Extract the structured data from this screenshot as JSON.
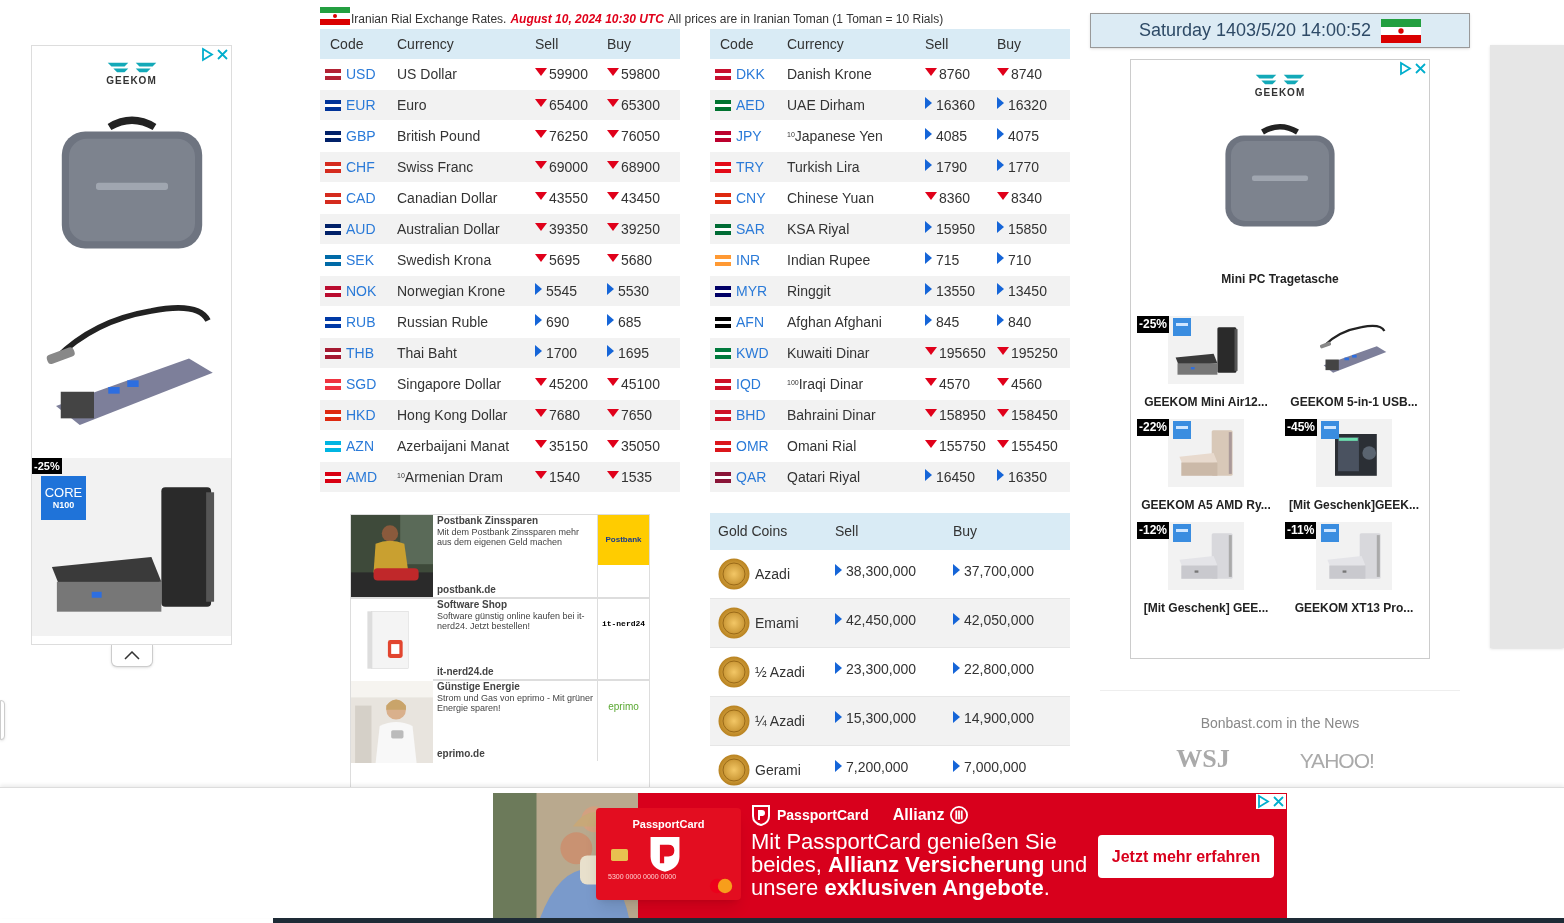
{
  "header": {
    "title": "Iranian Rial Exchange Rates.",
    "date": "August 10, 2024 10:30 UTC",
    "note": "All prices are in Iranian Toman (1 Toman = 10 Rials)"
  },
  "clock": {
    "text": "Saturday 1403/5/20 14:00:52"
  },
  "currency_tables": [
    {
      "columns": [
        "Code",
        "Currency",
        "Sell",
        "Buy"
      ],
      "rows": [
        {
          "code": "USD",
          "currency": "US Dollar",
          "color": "#b22234",
          "sell": "59900",
          "sell_up": false,
          "buy": "59800",
          "buy_up": false
        },
        {
          "code": "EUR",
          "currency": "Euro",
          "color": "#003399",
          "sell": "65400",
          "sell_up": false,
          "buy": "65300",
          "buy_up": false
        },
        {
          "code": "GBP",
          "currency": "British Pound",
          "color": "#012169",
          "sell": "76250",
          "sell_up": false,
          "buy": "76050",
          "buy_up": false
        },
        {
          "code": "CHF",
          "currency": "Swiss Franc",
          "color": "#d52b1e",
          "sell": "69000",
          "sell_up": false,
          "buy": "68900",
          "buy_up": false
        },
        {
          "code": "CAD",
          "currency": "Canadian Dollar",
          "color": "#d52b1e",
          "sell": "43550",
          "sell_up": false,
          "buy": "43450",
          "buy_up": false
        },
        {
          "code": "AUD",
          "currency": "Australian Dollar",
          "color": "#012169",
          "sell": "39350",
          "sell_up": false,
          "buy": "39250",
          "buy_up": false
        },
        {
          "code": "SEK",
          "currency": "Swedish Krona",
          "color": "#006aa7",
          "sell": "5695",
          "sell_up": false,
          "buy": "5680",
          "buy_up": false
        },
        {
          "code": "NOK",
          "currency": "Norwegian Krone",
          "color": "#ba0c2f",
          "sell": "5545",
          "sell_up": true,
          "buy": "5530",
          "buy_up": true
        },
        {
          "code": "RUB",
          "currency": "Russian Ruble",
          "color": "#0039a6",
          "sell": "690",
          "sell_up": true,
          "buy": "685",
          "buy_up": true
        },
        {
          "code": "THB",
          "currency": "Thai Baht",
          "color": "#a51931",
          "sell": "1700",
          "sell_up": true,
          "buy": "1695",
          "buy_up": true
        },
        {
          "code": "SGD",
          "currency": "Singapore Dollar",
          "color": "#ef3340",
          "sell": "45200",
          "sell_up": false,
          "buy": "45100",
          "buy_up": false
        },
        {
          "code": "HKD",
          "currency": "Hong Kong Dollar",
          "color": "#de2910",
          "sell": "7680",
          "sell_up": false,
          "buy": "7650",
          "buy_up": false
        },
        {
          "code": "AZN",
          "currency": "Azerbaijani Manat",
          "color": "#00b5e2",
          "sell": "35150",
          "sell_up": false,
          "buy": "35050",
          "buy_up": false
        },
        {
          "code": "AMD",
          "currency": "$^{10}$Armenian Dram",
          "color": "#d90012",
          "sell": "1540",
          "sell_up": false,
          "buy": "1535",
          "buy_up": false
        }
      ]
    },
    {
      "columns": [
        "Code",
        "Currency",
        "Sell",
        "Buy"
      ],
      "rows": [
        {
          "code": "DKK",
          "currency": "Danish Krone",
          "color": "#c8102e",
          "sell": "8760",
          "sell_up": false,
          "buy": "8740",
          "buy_up": false
        },
        {
          "code": "AED",
          "currency": "UAE Dirham",
          "color": "#00732f",
          "sell": "16360",
          "sell_up": true,
          "buy": "16320",
          "buy_up": true
        },
        {
          "code": "JPY",
          "currency": "$^{10}$Japanese Yen",
          "color": "#bc002d",
          "sell": "4085",
          "sell_up": true,
          "buy": "4075",
          "buy_up": true
        },
        {
          "code": "TRY",
          "currency": "Turkish Lira",
          "color": "#e30a17",
          "sell": "1790",
          "sell_up": true,
          "buy": "1770",
          "buy_up": true
        },
        {
          "code": "CNY",
          "currency": "Chinese Yuan",
          "color": "#de2910",
          "sell": "8360",
          "sell_up": false,
          "buy": "8340",
          "buy_up": false
        },
        {
          "code": "SAR",
          "currency": "KSA Riyal",
          "color": "#006c35",
          "sell": "15950",
          "sell_up": true,
          "buy": "15850",
          "buy_up": true
        },
        {
          "code": "INR",
          "currency": "Indian Rupee",
          "color": "#ff9933",
          "sell": "715",
          "sell_up": true,
          "buy": "710",
          "buy_up": true
        },
        {
          "code": "MYR",
          "currency": "Ringgit",
          "color": "#010066",
          "sell": "13550",
          "sell_up": true,
          "buy": "13450",
          "buy_up": true
        },
        {
          "code": "AFN",
          "currency": "Afghan Afghani",
          "color": "#000000",
          "sell": "845",
          "sell_up": true,
          "buy": "840",
          "buy_up": true
        },
        {
          "code": "KWD",
          "currency": "Kuwaiti Dinar",
          "color": "#007a3d",
          "sell": "195650",
          "sell_up": false,
          "buy": "195250",
          "buy_up": false
        },
        {
          "code": "IQD",
          "currency": "$^{100}$Iraqi Dinar",
          "color": "#ce1126",
          "sell": "4570",
          "sell_up": false,
          "buy": "4560",
          "buy_up": false
        },
        {
          "code": "BHD",
          "currency": "Bahraini Dinar",
          "color": "#ce1126",
          "sell": "158950",
          "sell_up": false,
          "buy": "158450",
          "buy_up": false
        },
        {
          "code": "OMR",
          "currency": "Omani Rial",
          "color": "#db161b",
          "sell": "155750",
          "sell_up": false,
          "buy": "155450",
          "buy_up": false
        },
        {
          "code": "QAR",
          "currency": "Qatari Riyal",
          "color": "#8a1538",
          "sell": "16450",
          "sell_up": true,
          "buy": "16350",
          "buy_up": true
        }
      ]
    }
  ],
  "gold_coins": {
    "columns": [
      "Gold Coins",
      "Sell",
      "Buy"
    ],
    "rows": [
      {
        "name": "Azadi",
        "sell": "38,300,000",
        "sell_up": true,
        "buy": "37,700,000",
        "buy_up": true
      },
      {
        "name": "Emami",
        "sell": "42,450,000",
        "sell_up": true,
        "buy": "42,050,000",
        "buy_up": true
      },
      {
        "name": "½ Azadi",
        "sell": "23,300,000",
        "sell_up": true,
        "buy": "22,800,000",
        "buy_up": true
      },
      {
        "name": "¼ Azadi",
        "sell": "15,300,000",
        "sell_up": true,
        "buy": "14,900,000",
        "buy_up": true
      },
      {
        "name": "Gerami",
        "sell": "7,200,000",
        "sell_up": true,
        "buy": "7,000,000",
        "buy_up": true
      }
    ]
  },
  "left_ad": {
    "logo": "GEEKOM",
    "badge": "-25%",
    "chip": "CORE",
    "chip_model": "N100"
  },
  "native_ads": [
    {
      "title": "Postbank Zinssparen",
      "description": "Mit dem Postbank Zinssparen mehr aus dem eigenen Geld machen",
      "domain": "postbank.de",
      "logo": "Postbank"
    },
    {
      "title": "Software Shop",
      "description": "Software günstig online kaufen bei it-nerd24. Jetzt bestellen!",
      "domain": "it-nerd24.de",
      "logo": "it-nerd24"
    },
    {
      "title": "Günstige Energie",
      "description": "Strom und Gas von eprimo - Mit grüner Energie sparen!",
      "domain": "eprimo.de",
      "logo": "eprimo"
    }
  ],
  "right_ad": {
    "logo": "GEEKOM",
    "title": "Mini PC Tragetasche",
    "products": [
      {
        "badge": "-25%",
        "name": "GEEKOM Mini Air12..."
      },
      {
        "name": "GEEKOM 5-in-1 USB..."
      },
      {
        "badge": "-22%",
        "name": "GEEKOM A5 AMD Ry..."
      },
      {
        "badge": "-45%",
        "name": "[Mit Geschenk]GEEK..."
      },
      {
        "badge": "-12%",
        "name": "[Mit Geschenk] GEE..."
      },
      {
        "badge": "-11%",
        "name": "GEEKOM XT13 Pro..."
      }
    ]
  },
  "news": {
    "title": "Bonbast.com in the News",
    "logos": [
      "WSJ",
      "YAHOO!"
    ]
  },
  "bottom_ad": {
    "card_brand": "PassportCard",
    "card_number": "5300 0000 0000 0000",
    "brand": "PassportCard",
    "partner": "Allianz",
    "headline": "Mit PassportCard genießen Sie beides, **Allianz Versicherung** und unsere **exklusiven Angebote**.",
    "button": "Jetzt mehr erfahren"
  }
}
